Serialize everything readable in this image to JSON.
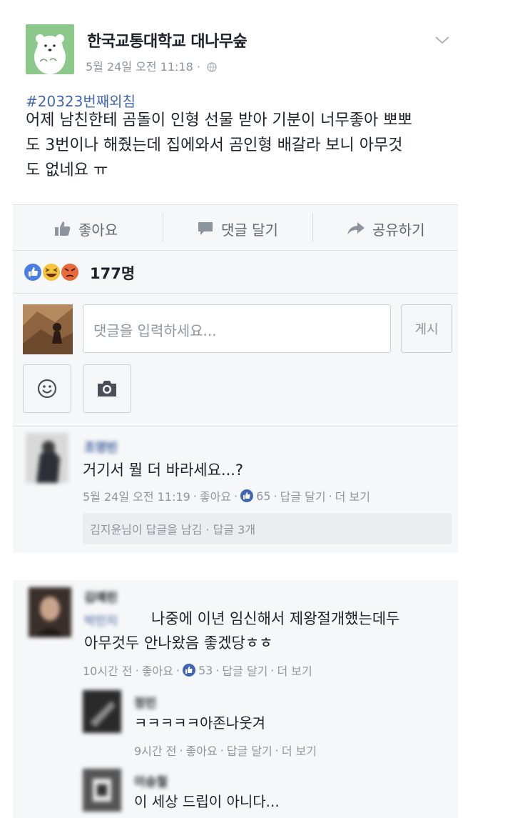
{
  "post": {
    "page_name": "한국교통대학교 대나무숲",
    "meta": "5월 24일 오전 11:18 ·",
    "hashtag": "#20323번째외침",
    "body_lines": [
      "어제 남친한테 곰돌이 인형 선물 받아 기분이 너무좋아 뽀뽀",
      "도 3번이나 해줬는데 집에와서 곰인형 배갈라 보니 아무것",
      "도 없네요 ㅠ"
    ]
  },
  "actions": {
    "like": "좋아요",
    "comment": "댓글 달기",
    "share": "공유하기"
  },
  "reactions": {
    "count": "177명",
    "types": [
      "like-icon",
      "haha-icon",
      "angry-icon"
    ]
  },
  "composer": {
    "placeholder": "댓글을 입력하세요...",
    "post_button": "게시"
  },
  "comments": [
    {
      "author": "조영빈",
      "text": "거기서 뭘 더 바라세요...?",
      "time": "5월 24일 오전 11:19",
      "like": "좋아요",
      "like_count": "65",
      "reply": "답글 달기",
      "more": "더 보기",
      "reply_summary": "김지윤님이 답글을 남김 · 답글 3개"
    },
    {
      "author": "김예린",
      "tagged": "박민지",
      "text_line1": "나중에 이년 임신해서 제왕절개했는데두",
      "text_line2": "아무것두 안나왔음 좋겠당ㅎㅎ",
      "time": "10시간 전",
      "like": "좋아요",
      "like_count": "53",
      "reply": "답글 달기",
      "more": "더 보기",
      "replies": [
        {
          "author": "정민",
          "text": "ㅋㅋㅋㅋㅋ아존나웃겨",
          "time": "9시간 전",
          "like": "좋아요",
          "reply": "답글 달기",
          "more": "더 보기"
        },
        {
          "author": "이승철",
          "text": "이 세상 드립이 아니다..."
        }
      ]
    }
  ],
  "colors": {
    "link_blue": "#4267b2",
    "name_blue": "#385898",
    "meta_grey": "#90949c",
    "panel_bg": "#f6f7f9"
  }
}
